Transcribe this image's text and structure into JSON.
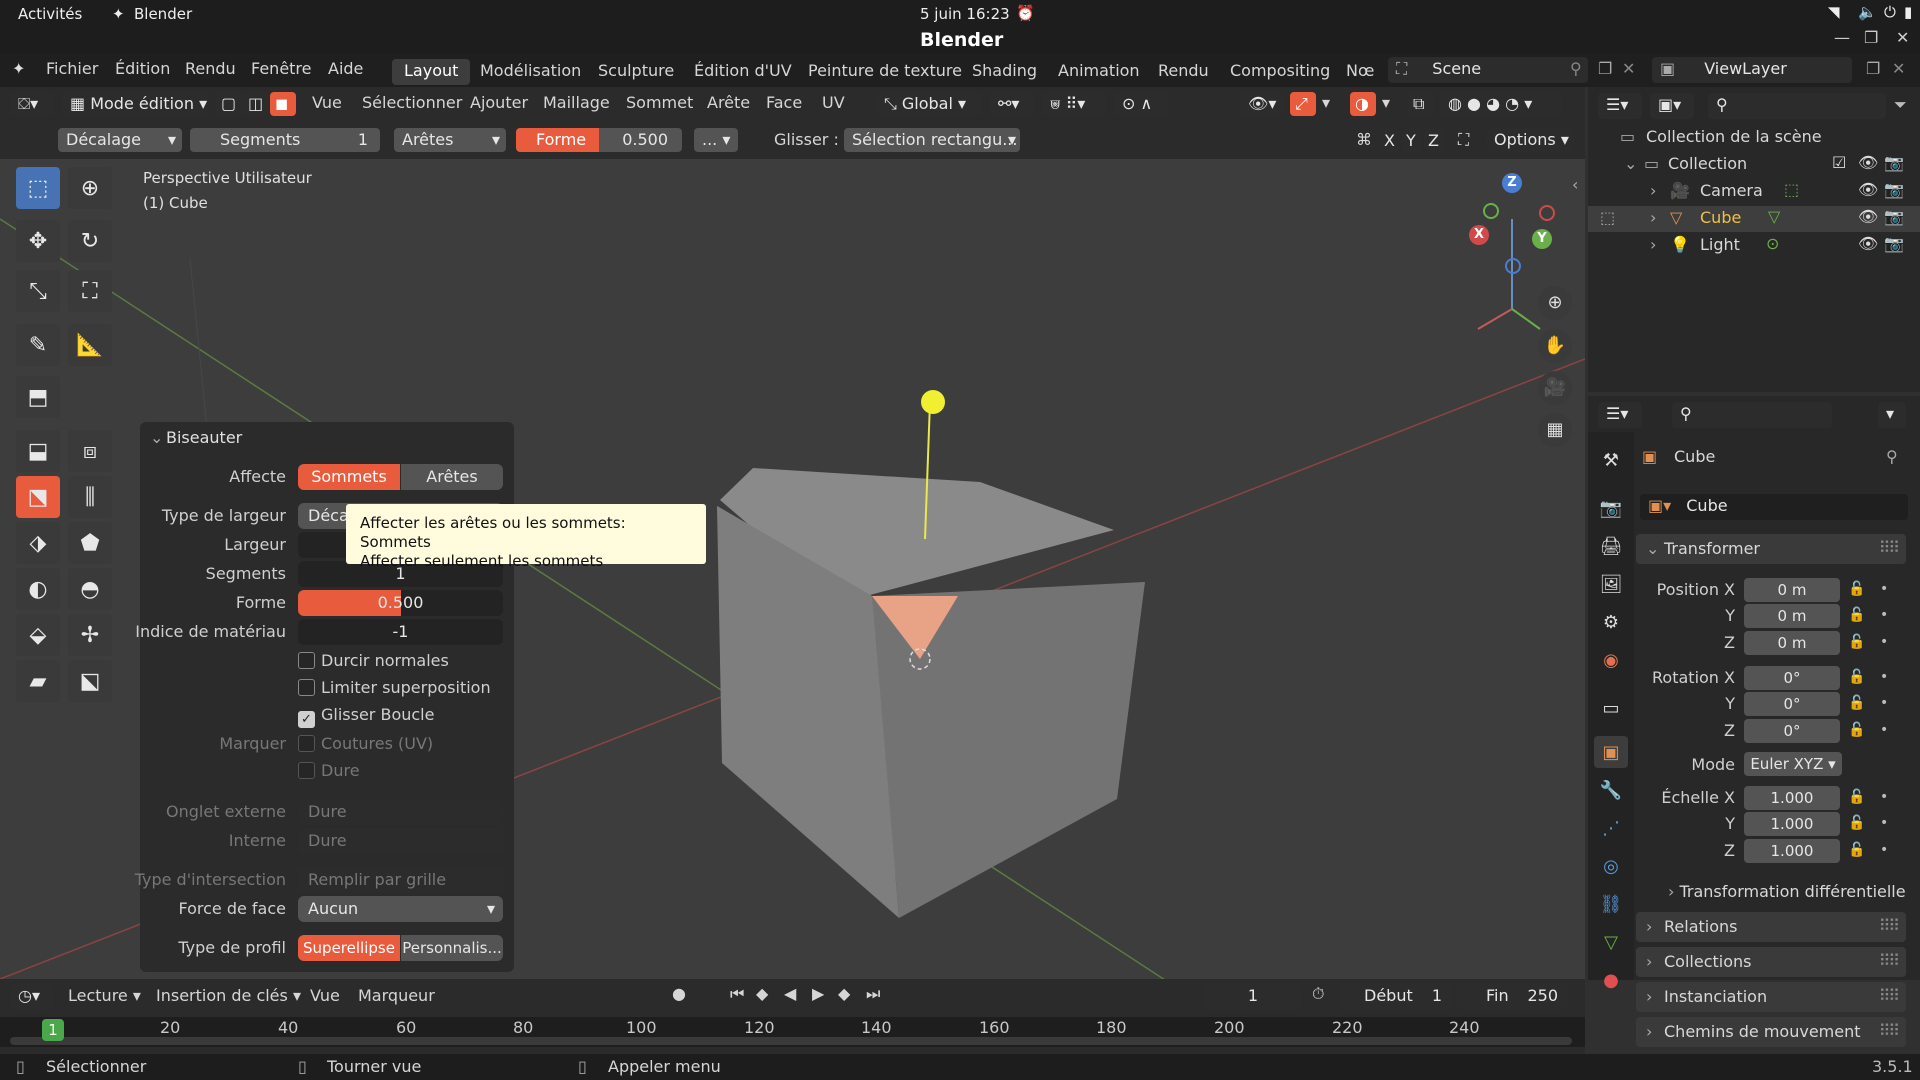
{
  "gnome": {
    "activities": "Activités",
    "app": "Blender",
    "datetime": "5 juin  16:23"
  },
  "window": {
    "title": "Blender"
  },
  "menu": {
    "items": [
      "Fichier",
      "Édition",
      "Rendu",
      "Fenêtre",
      "Aide"
    ]
  },
  "workspaces": {
    "tabs": [
      "Layout",
      "Modélisation",
      "Sculpture",
      "Édition d'UV",
      "Peinture de texture",
      "Shading",
      "Animation",
      "Rendu",
      "Compositing",
      "Nœ"
    ],
    "active": "Layout"
  },
  "scene": {
    "name": "Scene",
    "viewlayer": "ViewLayer"
  },
  "header": {
    "mode": "Mode édition",
    "items": [
      "Vue",
      "Sélectionner",
      "Ajouter",
      "Maillage",
      "Sommet",
      "Arête",
      "Face",
      "UV"
    ],
    "orientation": "Global"
  },
  "operator_header": {
    "offset": "Décalage",
    "segments_label": "Segments",
    "segments_value": "1",
    "edges": "Arêtes",
    "shape_label": "Forme",
    "shape_value": "0.500",
    "more": "...",
    "slide_label": "Glisser :",
    "slide_value": "Sélection rectangu...",
    "axes": [
      "X",
      "Y",
      "Z"
    ],
    "options": "Options"
  },
  "viewport": {
    "perspective": "Perspective Utilisateur",
    "object": "(1) Cube",
    "gizmo_axes": [
      "Z",
      "X",
      "Y"
    ]
  },
  "bevel_panel": {
    "title": "Biseauter",
    "affect_label": "Affecte",
    "affect_options": [
      "Sommets",
      "Arêtes"
    ],
    "affect_selected": "Sommets",
    "width_type_label": "Type de largeur",
    "width_type_value": "Déca",
    "width_label": "Largeur",
    "segments_label": "Segments",
    "segments_value": "1",
    "shape_label": "Forme",
    "shape_value": "0.500",
    "shape_fraction": 0.5,
    "material_label": "Indice de matériau",
    "material_value": "-1",
    "harden_normals": "Durcir normales",
    "clamp_overlap": "Limiter superposition",
    "loop_slide": "Glisser Boucle",
    "mark_label": "Marquer",
    "mark_seams": "Coutures (UV)",
    "mark_sharp": "Dure",
    "miter_outer_label": "Onglet externe",
    "miter_outer_value": "Dure",
    "miter_inner_label": "Interne",
    "miter_inner_value": "Dure",
    "intersection_label": "Type d'intersection",
    "intersection_value": "Remplir par grille",
    "face_strength_label": "Force de face",
    "face_strength_value": "Aucun",
    "profile_label": "Type de profil",
    "profile_options": [
      "Superellipse",
      "Personnalis..."
    ]
  },
  "tooltip": {
    "line1": "Affecter les arêtes ou les sommets:  Sommets",
    "line2": "Affecter seulement les sommets"
  },
  "outliner": {
    "scene_collection": "Collection de la scène",
    "collection": "Collection",
    "items": [
      "Camera",
      "Cube",
      "Light"
    ]
  },
  "properties": {
    "object_name": "Cube",
    "data_name": "Cube",
    "transform_title": "Transformer",
    "location_label": "Position X",
    "rotation_label": "Rotation X",
    "scale_label": "Échelle X",
    "axis_y": "Y",
    "axis_z": "Z",
    "location": [
      "0 m",
      "0 m",
      "0 m"
    ],
    "rotation": [
      "0°",
      "0°",
      "0°"
    ],
    "mode_label": "Mode",
    "mode_value": "Euler XYZ",
    "scale": [
      "1.000",
      "1.000",
      "1.000"
    ],
    "delta": "Transformation différentielle",
    "sections": [
      "Relations",
      "Collections",
      "Instanciation",
      "Chemins de mouvement"
    ]
  },
  "timeline": {
    "playback": "Lecture",
    "keying": "Insertion de clés",
    "view": "Vue",
    "marker": "Marqueur",
    "current_frame": "1",
    "start_label": "Début",
    "start_value": "1",
    "end_label": "Fin",
    "end_value": "250",
    "ticks": [
      "20",
      "40",
      "60",
      "80",
      "100",
      "120",
      "140",
      "160",
      "180",
      "200",
      "220",
      "240"
    ],
    "playhead": "1"
  },
  "status": {
    "select": "Sélectionner",
    "rotate": "Tourner vue",
    "menu": "Appeler menu",
    "version": "3.5.1"
  }
}
